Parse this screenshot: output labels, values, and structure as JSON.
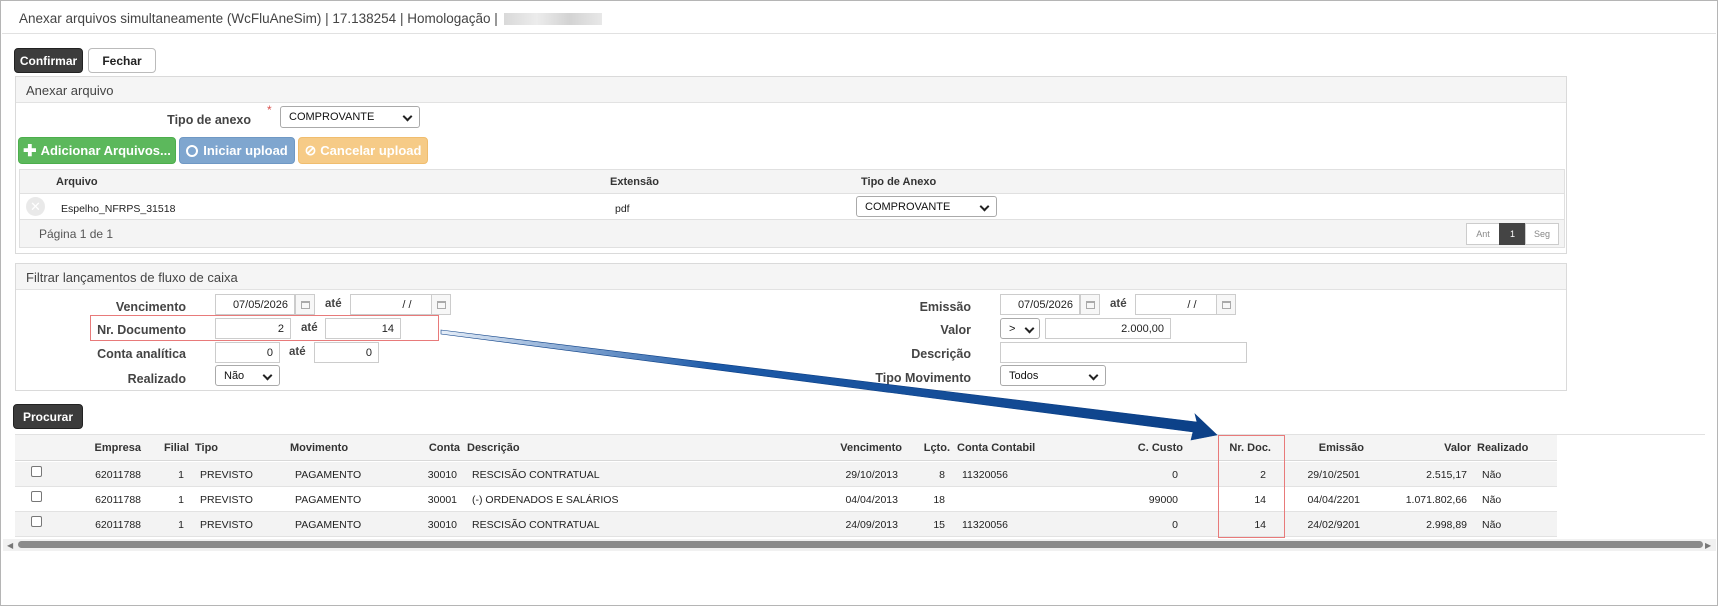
{
  "window": {
    "title": "Anexar arquivos simultaneamente (WcFluAneSim) | 17.138254 | Homologação |"
  },
  "toolbar": {
    "confirm_label": "Confirmar",
    "close_label": "Fechar"
  },
  "attach": {
    "panel_title": "Anexar arquivo",
    "type_label": "Tipo de anexo",
    "required_mark": "*",
    "type_value": "COMPROVANTE",
    "add_label": "Adicionar Arquivos...",
    "upload_label": "Iniciar upload",
    "cancel_label": "Cancelar upload",
    "columns": [
      "Arquivo",
      "Extensão",
      "Tipo de Anexo"
    ],
    "files": [
      {
        "name": "Espelho_NFRPS_31518",
        "ext": "pdf",
        "type": "COMPROVANTE"
      }
    ],
    "pagination": {
      "text": "Página 1 de 1",
      "prev": "Ant",
      "current": "1",
      "next": "Seg"
    }
  },
  "filter": {
    "panel_title": "Filtrar lançamentos de fluxo de caixa",
    "vencimento": {
      "label": "Vencimento",
      "from": "07/05/2026",
      "to": "/ /"
    },
    "nr_documento": {
      "label": "Nr. Documento",
      "from": "2",
      "to": "14"
    },
    "conta_analitica": {
      "label": "Conta analítica",
      "from": "0",
      "to": "0"
    },
    "realizado": {
      "label": "Realizado",
      "value": "Não"
    },
    "emissao": {
      "label": "Emissão",
      "from": "07/05/2026",
      "to": "/ /"
    },
    "valor": {
      "label": "Valor",
      "operator": ">",
      "value": "2.000,00"
    },
    "descricao": {
      "label": "Descrição",
      "value": ""
    },
    "tipo_movimento": {
      "label": "Tipo Movimento",
      "value": "Todos"
    },
    "ate_label": "até"
  },
  "search": {
    "label": "Procurar"
  },
  "results": {
    "columns": {
      "empresa": "Empresa",
      "filial": "Filial",
      "tipo": "Tipo",
      "movimento": "Movimento",
      "conta": "Conta",
      "descricao": "Descrição",
      "vencimento": "Vencimento",
      "lcto": "Lçto.",
      "conta_contabil": "Conta Contabil",
      "c_custo": "C. Custo",
      "nr_doc": "Nr. Doc.",
      "emissao": "Emissão",
      "valor": "Valor",
      "realizado": "Realizado"
    },
    "rows": [
      {
        "empresa": "62011788",
        "filial": "1",
        "tipo": "PREVISTO",
        "movimento": "PAGAMENTO",
        "conta": "30010",
        "descricao": "RESCISÃO CONTRATUAL",
        "vencimento": "29/10/2013",
        "lcto": "8",
        "conta_contabil": "11320056",
        "c_custo": "0",
        "nr_doc": "2",
        "emissao": "29/10/2501",
        "valor": "2.515,17",
        "realizado": "Não"
      },
      {
        "empresa": "62011788",
        "filial": "1",
        "tipo": "PREVISTO",
        "movimento": "PAGAMENTO",
        "conta": "30001",
        "descricao": "(-) ORDENADOS E SALÁRIOS",
        "vencimento": "04/04/2013",
        "lcto": "18",
        "conta_contabil": "",
        "c_custo": "99000",
        "nr_doc": "14",
        "emissao": "04/04/2201",
        "valor": "1.071.802,66",
        "realizado": "Não"
      },
      {
        "empresa": "62011788",
        "filial": "1",
        "tipo": "PREVISTO",
        "movimento": "PAGAMENTO",
        "conta": "30010",
        "descricao": "RESCISÃO CONTRATUAL",
        "vencimento": "24/09/2013",
        "lcto": "15",
        "conta_contabil": "11320056",
        "c_custo": "0",
        "nr_doc": "14",
        "emissao": "24/02/9201",
        "valor": "2.998,89",
        "realizado": "Não"
      }
    ]
  },
  "colors": {
    "green": "#5cb85c",
    "blue": "#7fa6cf",
    "orange": "#f6cb87",
    "dark": "#3c3c3c",
    "highlight": "#e87a7a",
    "arrow": "#0b3f86"
  }
}
